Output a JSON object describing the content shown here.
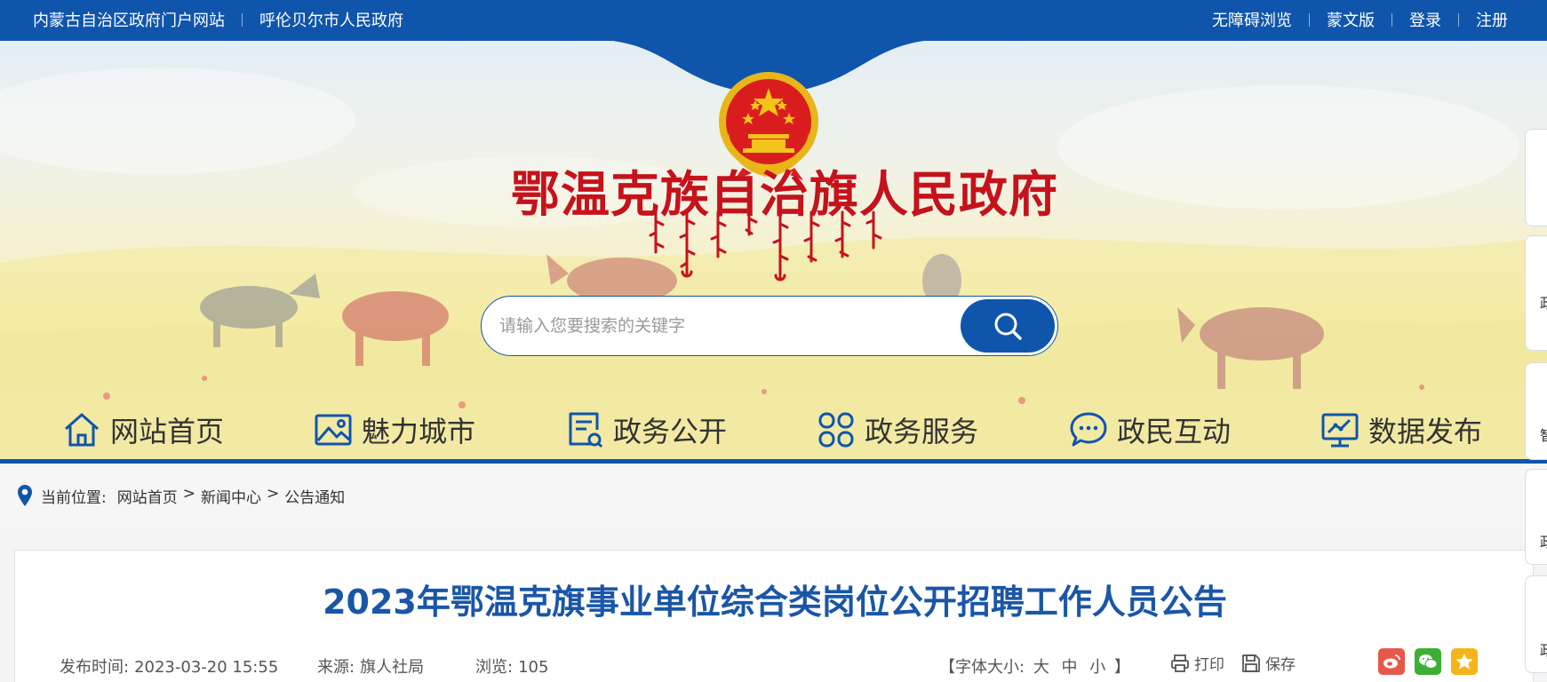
{
  "topbar": {
    "left_links": [
      "内蒙古自治区政府门户网站",
      "呼伦贝尔市人民政府"
    ],
    "right_links": [
      "无障碍浏览",
      "蒙文版",
      "登录",
      "注册"
    ]
  },
  "header": {
    "site_title": "鄂温克族自治旗人民政府",
    "emblem": "national-emblem-icon"
  },
  "search": {
    "placeholder": "请输入您要搜索的关键字",
    "value": "",
    "button_icon": "search-icon"
  },
  "nav": {
    "items": [
      {
        "label": "网站首页",
        "icon": "home-icon"
      },
      {
        "label": "魅力城市",
        "icon": "image-icon"
      },
      {
        "label": "政务公开",
        "icon": "document-icon"
      },
      {
        "label": "政务服务",
        "icon": "grid-icon"
      },
      {
        "label": "政民互动",
        "icon": "chat-icon"
      },
      {
        "label": "数据发布",
        "icon": "chart-monitor-icon"
      }
    ]
  },
  "breadcrumb": {
    "label": "当前位置:",
    "items": [
      "网站首页",
      "新闻中心",
      "公告通知"
    ],
    "separator": ">"
  },
  "article": {
    "title": "2023年鄂温克旗事业单位综合类岗位公开招聘工作人员公告",
    "publish_label": "发布时间:",
    "publish_time": "2023-03-20 15:55",
    "source_label": "来源:",
    "source": "旗人社局",
    "views_label": "浏览:",
    "views": "105",
    "font_size_open": "【字体大小:",
    "font_sizes": [
      "大",
      "中",
      "小"
    ],
    "font_size_close": "】",
    "print_label": "打印",
    "save_label": "保存",
    "share_icons": [
      "weibo-icon",
      "wechat-icon",
      "qzone-icon"
    ]
  },
  "side_tabs": {
    "labels": [
      "政",
      "智",
      "政",
      "政"
    ]
  },
  "colors": {
    "primary": "#0f55ac",
    "title_red": "#c6121b",
    "article_title": "#1a56a8",
    "weibo": "#e8584a",
    "wechat": "#3cb035",
    "qzone": "#f5b51a"
  }
}
